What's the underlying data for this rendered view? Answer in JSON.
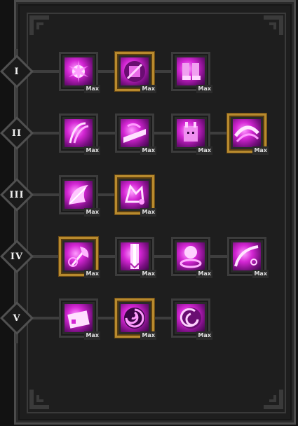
{
  "tree": {
    "tiers": [
      {
        "label": "I",
        "skills": [
          {
            "name": "burst-icon",
            "gold": false,
            "max": "Max"
          },
          {
            "name": "fist-icon",
            "gold": true,
            "max": "Max"
          },
          {
            "name": "boots-icon",
            "gold": false,
            "max": "Max"
          }
        ]
      },
      {
        "label": "II",
        "skills": [
          {
            "name": "claw-icon",
            "gold": false,
            "max": "Max"
          },
          {
            "name": "dash-icon",
            "gold": false,
            "max": "Max"
          },
          {
            "name": "beast-icon",
            "gold": false,
            "max": "Max"
          },
          {
            "name": "arc-slash-icon",
            "gold": true,
            "max": "Max"
          }
        ]
      },
      {
        "label": "III",
        "skills": [
          {
            "name": "cleave-icon",
            "gold": false,
            "max": "Max"
          },
          {
            "name": "sigil-icon",
            "gold": true,
            "max": "Max"
          }
        ]
      },
      {
        "label": "IV",
        "skills": [
          {
            "name": "axe-icon",
            "gold": true,
            "max": "Max"
          },
          {
            "name": "beam-icon",
            "gold": false,
            "max": "Max"
          },
          {
            "name": "orb-ring-icon",
            "gold": false,
            "max": "Max"
          },
          {
            "name": "spiral-wave-icon",
            "gold": false,
            "max": "Max"
          }
        ]
      },
      {
        "label": "V",
        "skills": [
          {
            "name": "card-icon",
            "gold": false,
            "max": "Max"
          },
          {
            "name": "vortex-icon",
            "gold": true,
            "max": "Max"
          },
          {
            "name": "swirl-icon",
            "gold": false,
            "max": "Max"
          }
        ]
      }
    ]
  },
  "colors": {
    "gold_border": "#b88a2e",
    "skill_magenta": "#d426d4",
    "panel": "#1e1e1e"
  }
}
